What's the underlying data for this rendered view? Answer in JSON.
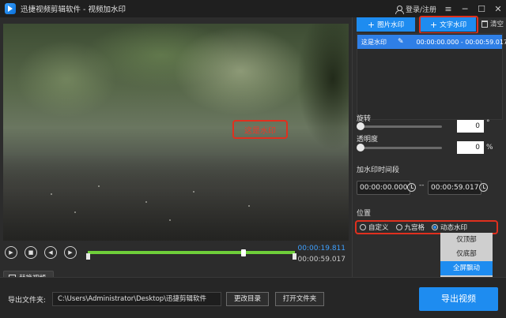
{
  "window": {
    "title": "迅捷视频剪辑软件 - 视频加水印",
    "login": "登录/注册"
  },
  "preview": {
    "watermark_text": "这是水印"
  },
  "player": {
    "current_time": "00:00:19.811",
    "total_time": "00:00:59.017",
    "progress": 0.33,
    "replace_label": "替换视频"
  },
  "watermark_panel": {
    "add_image_label": "图片水印",
    "add_text_label": "文字水印",
    "clear_label": "清空",
    "items": [
      {
        "name": "这是水印",
        "range": "00:00:00.000 - 00:00:59.017"
      }
    ]
  },
  "properties": {
    "rotate_label": "旋转",
    "rotate_value": "0",
    "rotate_unit": "°",
    "opacity_label": "透明度",
    "opacity_value": "0",
    "opacity_unit": "%",
    "time_label": "加水印时间段",
    "start_time": "00:00:00.000",
    "dash": "--",
    "end_time": "00:00:59.017",
    "position_label": "位置",
    "position_options": [
      "自定义",
      "九宫格",
      "动态水印"
    ],
    "position_selected": "动态水印",
    "dynamic_options": [
      "仅顶部",
      "仅底部",
      "全屏飘动"
    ],
    "dynamic_selected": "全屏飘动"
  },
  "footer": {
    "export_folder_label": "导出文件夹:",
    "export_path": "C:\\Users\\Administrator\\Desktop\\迅捷剪辑软件",
    "change_dir_label": "更改目录",
    "open_folder_label": "打开文件夹",
    "export_video_label": "导出视频"
  },
  "colors": {
    "accent": "#1e8cf0",
    "highlight": "#e0301e",
    "timeline": "#6fcf3a",
    "time_current": "#3ea0ff"
  }
}
